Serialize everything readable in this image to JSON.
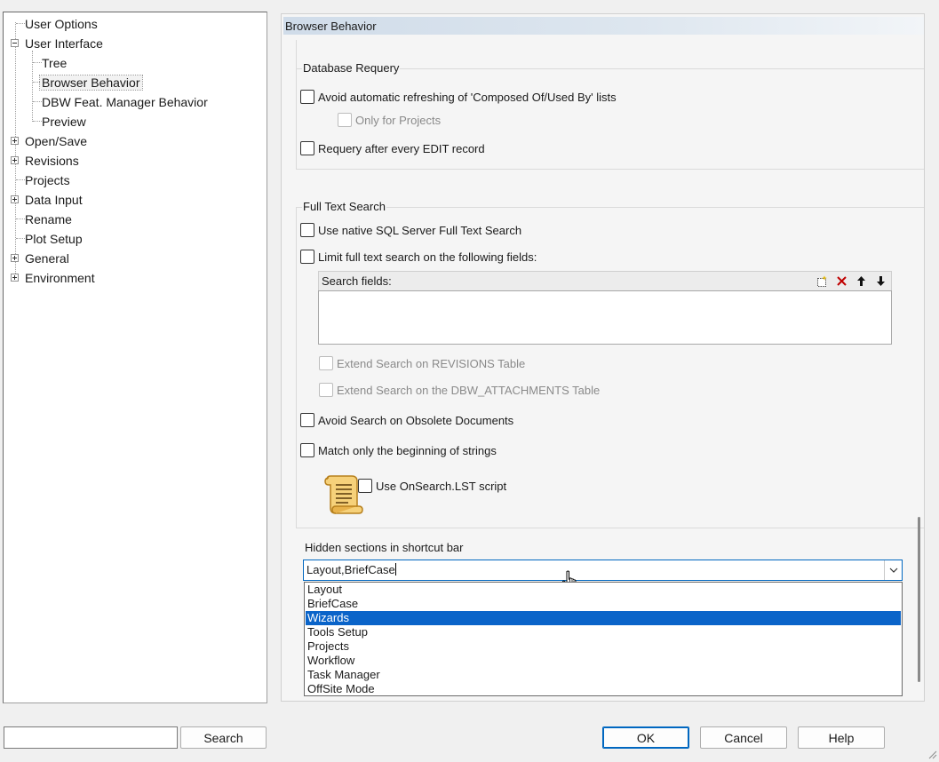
{
  "tree": {
    "items": [
      {
        "label": "User Options",
        "level": 0,
        "expander": "none"
      },
      {
        "label": "User Interface",
        "level": 0,
        "expander": "minus"
      },
      {
        "label": "Tree",
        "level": 1,
        "expander": "none"
      },
      {
        "label": "Browser Behavior",
        "level": 1,
        "expander": "none",
        "selected": true
      },
      {
        "label": "DBW Feat. Manager Behavior",
        "level": 1,
        "expander": "none"
      },
      {
        "label": "Preview",
        "level": 1,
        "expander": "none"
      },
      {
        "label": "Open/Save",
        "level": 0,
        "expander": "plus"
      },
      {
        "label": "Revisions",
        "level": 0,
        "expander": "plus"
      },
      {
        "label": "Projects",
        "level": 0,
        "expander": "none"
      },
      {
        "label": "Data Input",
        "level": 0,
        "expander": "plus"
      },
      {
        "label": "Rename",
        "level": 0,
        "expander": "none"
      },
      {
        "label": "Plot Setup",
        "level": 0,
        "expander": "none"
      },
      {
        "label": "General",
        "level": 0,
        "expander": "plus"
      },
      {
        "label": "Environment",
        "level": 0,
        "expander": "plus"
      }
    ]
  },
  "panel": {
    "title": "Browser Behavior",
    "database_requery": {
      "title": "Database Requery",
      "avoid_refresh": "Avoid automatic refreshing of 'Composed Of/Used By' lists",
      "only_projects": "Only for Projects",
      "requery_edit": "Requery after every EDIT record"
    },
    "full_text_search": {
      "title": "Full Text Search",
      "native_sql": "Use native SQL Server Full Text Search",
      "limit_fields": "Limit full text search on the following fields:",
      "search_fields_header": "Search fields:",
      "extend_revisions": "Extend Search on REVISIONS Table",
      "extend_attachments": "Extend Search on the DBW_ATTACHMENTS Table",
      "avoid_obsolete": "Avoid Search on Obsolete Documents",
      "match_beginning": "Match only the beginning of strings",
      "onsearch_script": "Use OnSearch.LST script"
    },
    "shortcut_bar": {
      "label": "Hidden sections in shortcut bar",
      "value": "Layout,BriefCase",
      "options": [
        "Layout",
        "BriefCase",
        "Wizards",
        "Tools Setup",
        "Projects",
        "Workflow",
        "Task Manager",
        "OffSite Mode"
      ],
      "highlighted_index": 2
    }
  },
  "bottom": {
    "search_value": "",
    "search_button": "Search",
    "ok_button": "OK",
    "cancel_button": "Cancel",
    "help_button": "Help"
  },
  "colors": {
    "accent": "#0067c0",
    "highlight": "#0a64c9"
  }
}
